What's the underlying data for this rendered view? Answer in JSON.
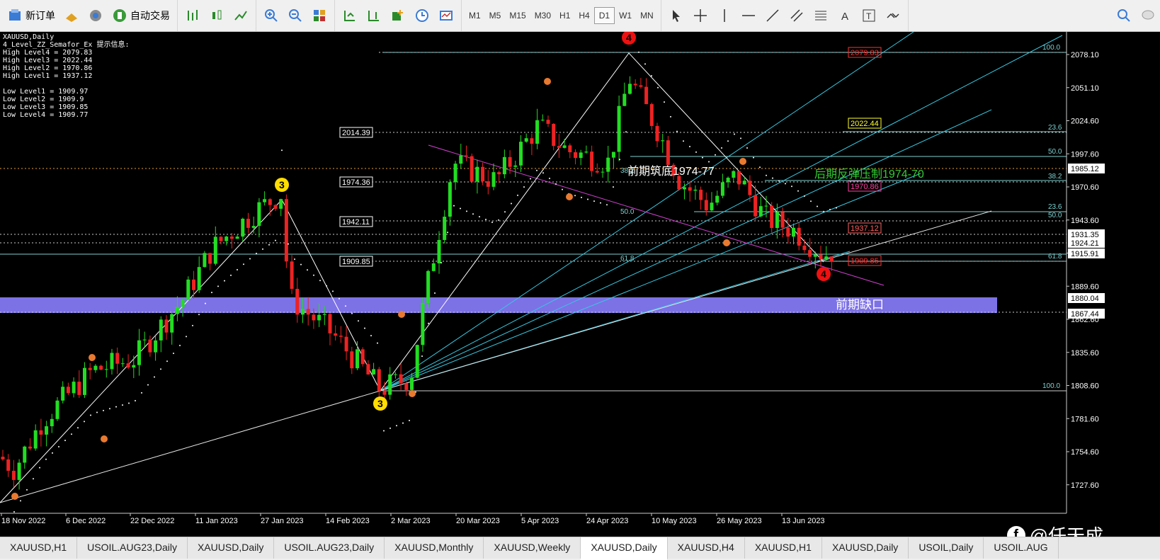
{
  "toolbar": {
    "new_order": "新订单",
    "auto_trading": "自动交易",
    "timeframes": [
      "M1",
      "M5",
      "M15",
      "M30",
      "H1",
      "H4",
      "D1",
      "W1",
      "MN"
    ],
    "active_timeframe": "D1"
  },
  "chart": {
    "symbol": "XAUUSD,Daily",
    "indicator": "4_Level_ZZ_Semafor_Ex 提示信息:",
    "levels": [
      "High Level4 = 2079.83",
      "High Level3 = 2022.44",
      "High Level2 = 1970.86",
      "High Level1 = 1937.12",
      "",
      "Low Level1 = 1909.97",
      "Low Level2 = 1909.9",
      "Low Level3 = 1909.85",
      "Low Level4 = 1909.77"
    ],
    "price_axis": [
      "2078.10",
      "2051.10",
      "2024.60",
      "1997.60",
      "1970.60",
      "1943.60",
      "1916.60",
      "1889.60",
      "1862.60",
      "1835.60",
      "1808.60",
      "1781.60",
      "1754.60",
      "1727.60"
    ],
    "price_tags": [
      {
        "text": "1985.12",
        "bg": "#ffffff",
        "fg": "#000000"
      },
      {
        "text": "1931.35",
        "bg": "#ffffff",
        "fg": "#000000"
      },
      {
        "text": "1924.21",
        "bg": "#ffffff",
        "fg": "#000000"
      },
      {
        "text": "1915.91",
        "bg": "#ffffff",
        "fg": "#000000"
      },
      {
        "text": "1880.04",
        "bg": "#ffffff",
        "fg": "#000000"
      },
      {
        "text": "1867.44",
        "bg": "#ffffff",
        "fg": "#000000"
      }
    ],
    "date_axis": [
      "18 Nov 2022",
      "6 Dec 2022",
      "22 Dec 2022",
      "11 Jan 2023",
      "27 Jan 2023",
      "14 Feb 2023",
      "2 Mar 2023",
      "20 Mar 2023",
      "5 Apr 2023",
      "24 Apr 2023",
      "10 May 2023",
      "26 May 2023",
      "13 Jun 2023"
    ],
    "level_labels": [
      "2014.39",
      "1974.36",
      "1942.11",
      "1909.85"
    ],
    "semafor_labels": [
      "2079.83",
      "2022.44",
      "1970.86",
      "1937.12",
      "1909.85"
    ],
    "fib_labels": [
      "100.0",
      "23.6",
      "50.0",
      "38.2",
      "23.6",
      "50.0",
      "61.8",
      "100.0",
      "38.2",
      "50.0",
      "61.8"
    ],
    "annotations": {
      "prev_bottom": "前期筑底1974-77",
      "rebound": "后期反弹压制1974-70",
      "gap": "前期缺口"
    },
    "markers": [
      "3",
      "3",
      "4",
      "4"
    ]
  },
  "tabs": [
    "XAUUSD,H1",
    "USOIL.AUG23,Daily",
    "XAUUSD,Daily",
    "USOIL.AUG23,Daily",
    "XAUUSD,Monthly",
    "XAUUSD,Weekly",
    "XAUUSD,Daily",
    "XAUUSD,H4",
    "XAUUSD,H1",
    "XAUUSD,Daily",
    "USOIL,Daily",
    "USOIL.AUG"
  ],
  "active_tab": 6,
  "brand": "@任天成"
}
